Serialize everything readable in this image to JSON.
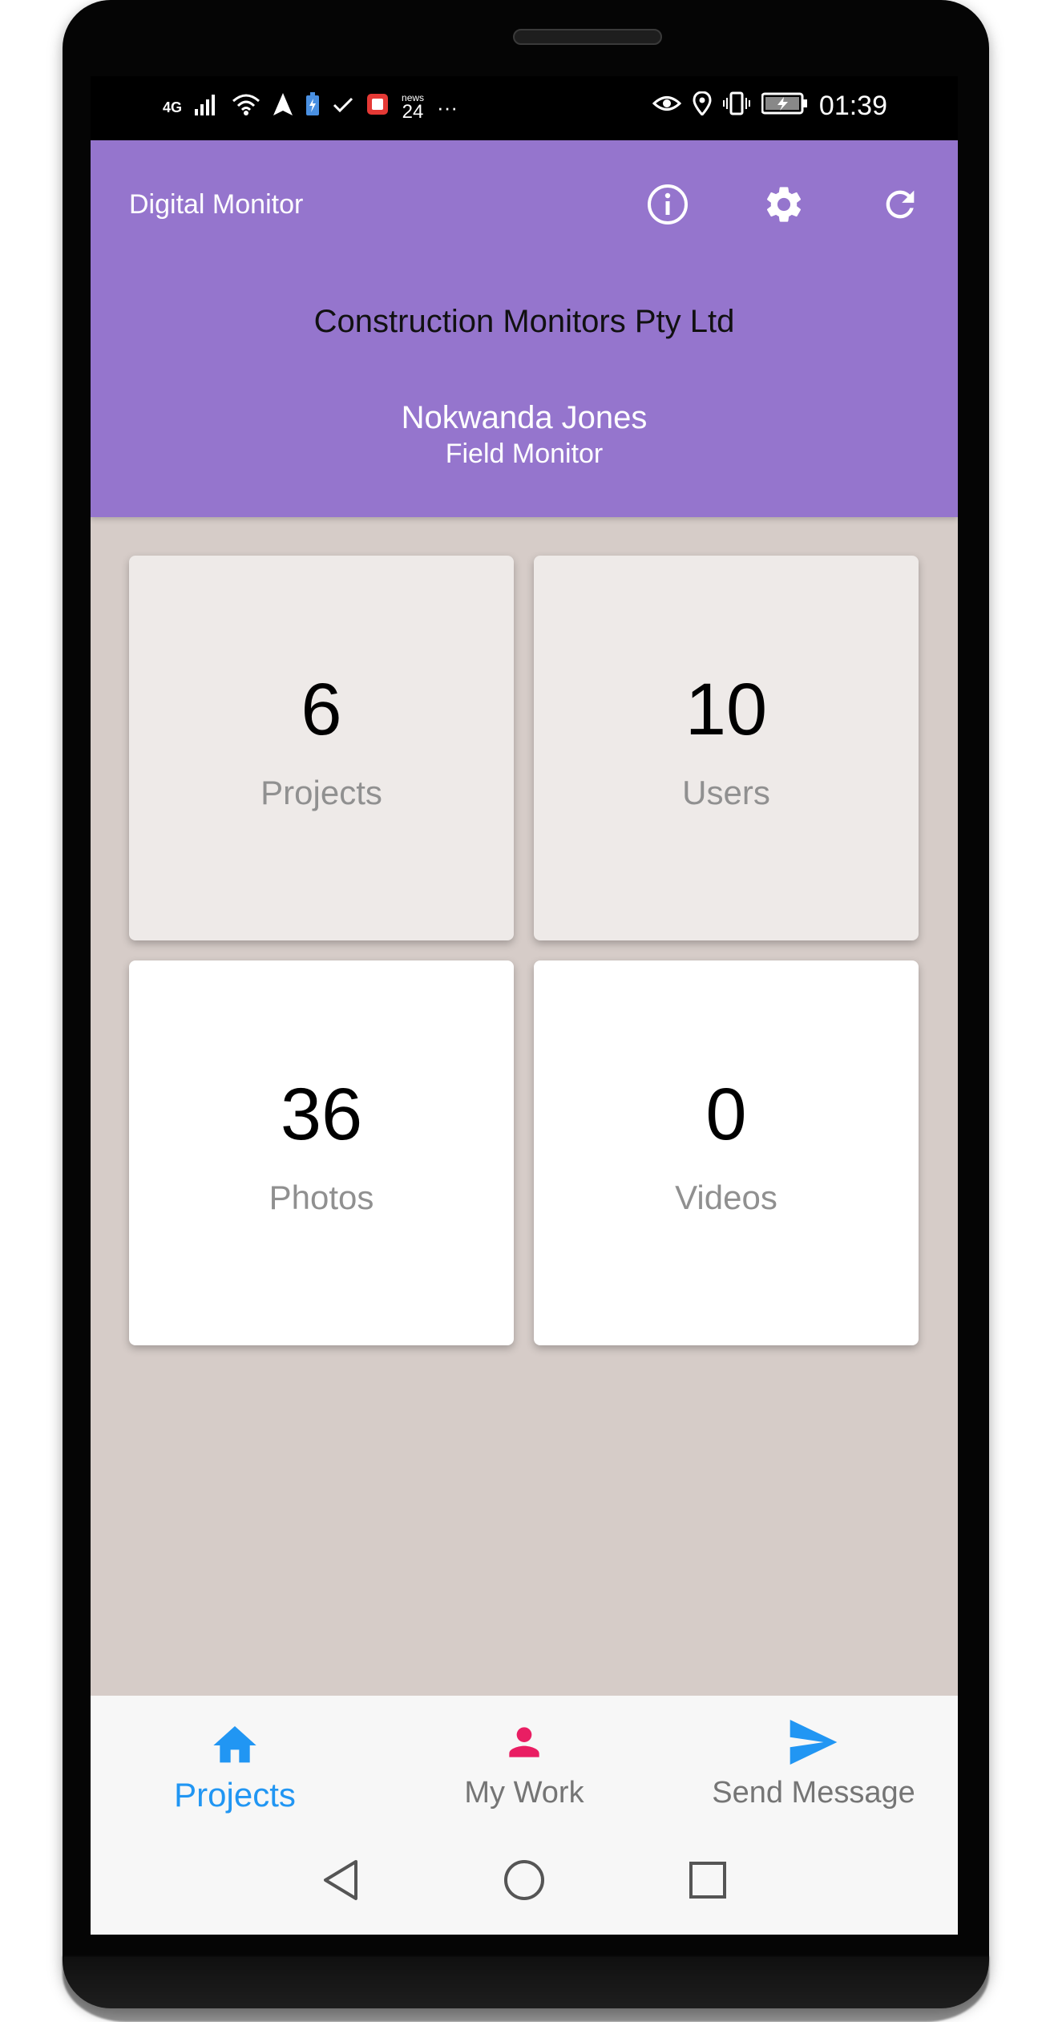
{
  "status_bar": {
    "network": "4G",
    "news_label": "news",
    "news_number": "24",
    "more": "···",
    "time": "01:39"
  },
  "header": {
    "app_title": "Digital Monitor",
    "company": "Construction Monitors Pty Ltd",
    "user_name": "Nokwanda Jones",
    "user_role": "Field Monitor",
    "icons": [
      "info-icon",
      "settings-gear-icon",
      "refresh-icon"
    ]
  },
  "stats": [
    {
      "value": "6",
      "label": "Projects"
    },
    {
      "value": "10",
      "label": "Users"
    },
    {
      "value": "36",
      "label": "Photos"
    },
    {
      "value": "0",
      "label": "Videos"
    }
  ],
  "bottom_nav": {
    "items": [
      {
        "label": "Projects",
        "icon": "home-icon",
        "active": true
      },
      {
        "label": "My Work",
        "icon": "person-icon",
        "active": false
      },
      {
        "label": "Send Message",
        "icon": "send-icon",
        "active": false
      }
    ]
  },
  "colors": {
    "header": "#9575cd",
    "background": "#d6ccc8",
    "active_nav": "#2196f3",
    "my_work_icon": "#e91e63",
    "send_icon": "#2196f3"
  }
}
